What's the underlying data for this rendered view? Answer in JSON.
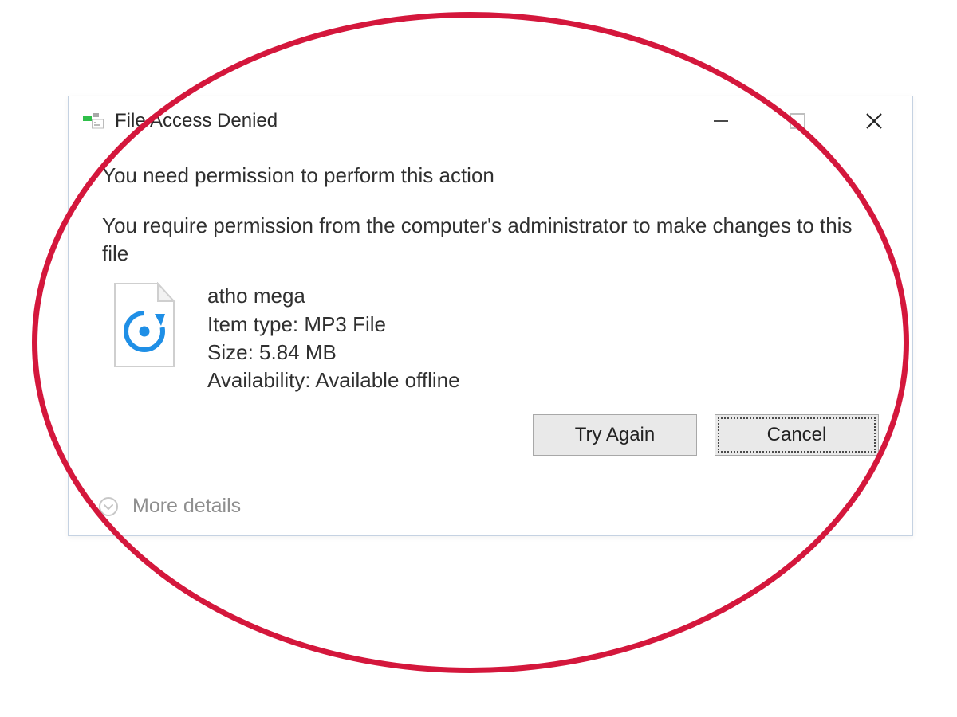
{
  "dialog": {
    "title": "File Access Denied",
    "heading": "You need permission to perform this action",
    "description": "You require permission from the computer's administrator to make changes to this file",
    "file": {
      "name": "atho mega",
      "type_label": "Item type: MP3 File",
      "size_label": "Size: 5.84 MB",
      "availability_label": "Availability: Available offline"
    },
    "buttons": {
      "try_again": "Try Again",
      "cancel": "Cancel"
    },
    "more_details": "More details"
  }
}
